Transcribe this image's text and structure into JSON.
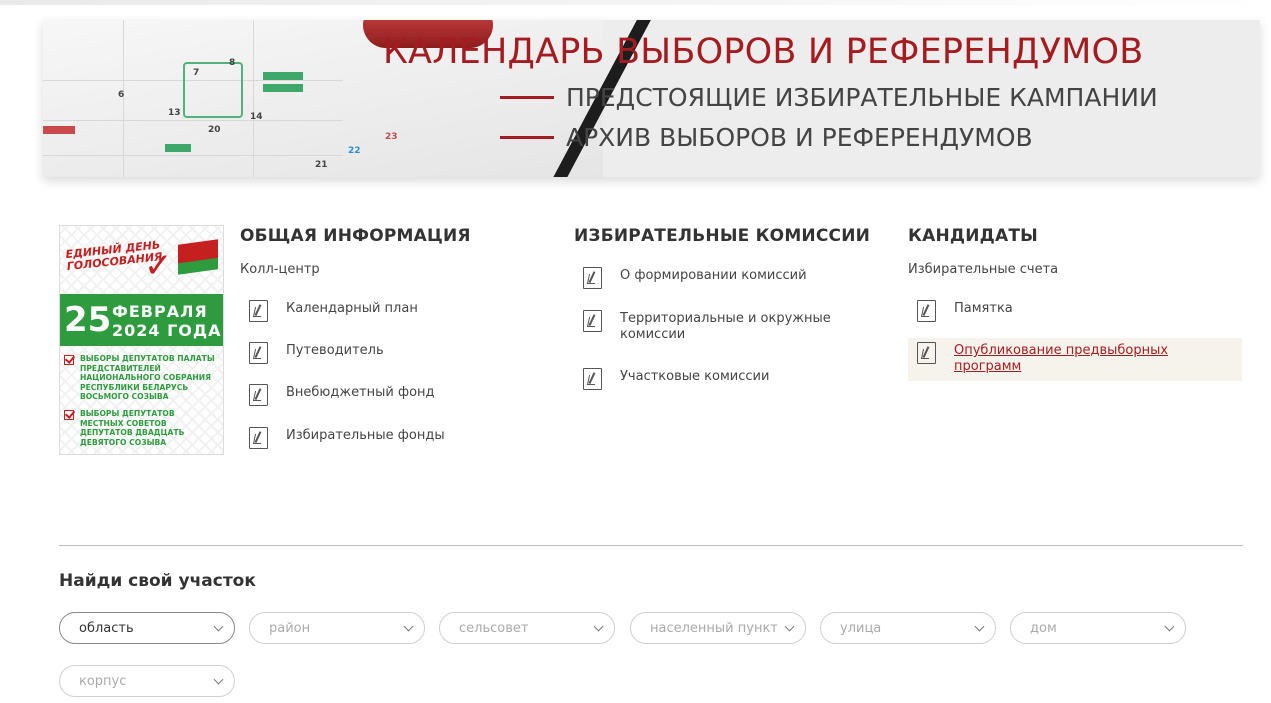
{
  "banner": {
    "title": "КАЛЕНДАРЬ ВЫБОРОВ И РЕФЕРЕНДУМОВ",
    "links": [
      "ПРЕДСТОЯЩИЕ ИЗБИРАТЕЛЬНЫЕ КАМПАНИИ",
      "АРХИВ ВЫБОРОВ И РЕФЕРЕНДУМОВ"
    ],
    "calendar_numbers": [
      "6",
      "7",
      "8",
      "13",
      "14",
      "20",
      "21",
      "22",
      "23"
    ]
  },
  "poster": {
    "brand_line1": "ЕДИНЫЙ ДЕНЬ",
    "brand_line2": "ГОЛОСОВАНИЯ",
    "day": "25",
    "month": "ФЕВРАЛЯ",
    "year": "2024 ГОДА",
    "item1": "ВЫБОРЫ ДЕПУТАТОВ ПАЛАТЫ ПРЕДСТАВИТЕЛЕЙ НАЦИОНАЛЬНОГО СОБРАНИЯ РЕСПУБЛИКИ БЕЛАРУСЬ ВОСЬМОГО СОЗЫВА",
    "item2": "ВЫБОРЫ ДЕПУТАТОВ МЕСТНЫХ СОВЕТОВ ДЕПУТАТОВ ДВАДЦАТЬ ДЕВЯТОГО СОЗЫВА"
  },
  "general": {
    "title": "ОБЩАЯ ИНФОРМАЦИЯ",
    "sub": "Колл-центр",
    "docs": [
      "Календарный план",
      "Путеводитель",
      "Внебюджетный фонд",
      "Избирательные фонды"
    ]
  },
  "commissions": {
    "title": "ИЗБИРАТЕЛЬНЫЕ КОМИССИИ",
    "docs": [
      "О формировании комиссий",
      "Территориальные и окружные комиссии",
      "Участковые комиссии"
    ]
  },
  "candidates": {
    "title": "КАНДИДАТЫ",
    "sub": "Избирательные счета",
    "docs": [
      "Памятка",
      "Опубликование предвыборных программ"
    ]
  },
  "find": {
    "title": "Найди свой участок",
    "selects": [
      "область",
      "район",
      "сельсовет",
      "населенный пункт",
      "улица",
      "дом",
      "корпус"
    ]
  },
  "colors": {
    "accent": "#a51c20",
    "green": "#2e9b3e"
  }
}
